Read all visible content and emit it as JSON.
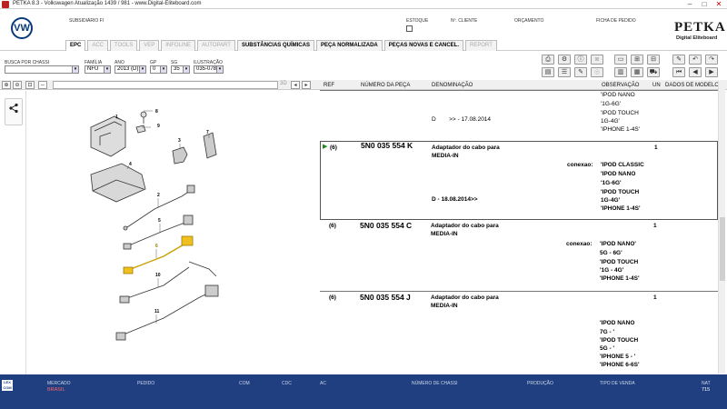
{
  "window": {
    "title": "PETKA 8.3 - Volkswagen Atualização 1439 / 981 - www.Digital-Eliteboard.com"
  },
  "header": {
    "brand_logo": "VW",
    "subsidiary_label": "SUBSIDIÁRIO FI",
    "estoque_label": "ESTOQUE",
    "cliente_label": "Nº. CLIENTE",
    "orcamento_label": "ORÇAMENTO",
    "ficha_label": "FICHA DE PEDIDO",
    "petka_title": "PETKA",
    "petka_sub": "Digital Eliteboard"
  },
  "tabs": [
    {
      "label": "EPC",
      "state": "active"
    },
    {
      "label": "ACC",
      "state": "disabled"
    },
    {
      "label": "TOOLS",
      "state": "disabled"
    },
    {
      "label": "VEP",
      "state": "disabled"
    },
    {
      "label": "INFOLINE",
      "state": "disabled"
    },
    {
      "label": "AUTOPART",
      "state": "disabled"
    },
    {
      "label": "SUBSTÂNCIAS QUÍMICAS",
      "state": "enabled"
    },
    {
      "label": "PEÇA NORMALIZADA",
      "state": "enabled"
    },
    {
      "label": "PEÇAS NOVAS E CANCEL.",
      "state": "enabled"
    },
    {
      "label": "REPORT",
      "state": "disabled"
    }
  ],
  "filters": {
    "chassi_label": "BUSCA POR CHASSI",
    "chassi_value": "",
    "familia_label": "FAMÍLIA",
    "familia_value": "NFU",
    "ano_label": "ANO",
    "ano_value": "2013 (D)",
    "gp_label": "GP",
    "gp_value": "0",
    "sg_label": "SG",
    "sg_value": "35",
    "ilustracao_label": "ILUSTRAÇÃO",
    "ilustracao_value": "035-078"
  },
  "zoom_page": "3D",
  "table": {
    "headers": {
      "ref": "REF",
      "part_number": "NÚMERO DA PEÇA",
      "denominacao": "DENOMINAÇÃO",
      "observacao": "OBSERVAÇÃO",
      "un": "UN",
      "dados": "DADOS DE MODELO"
    },
    "top_partial": {
      "obs": [
        "'IPOD NANO",
        "'1G-6G'",
        "'IPOD TOUCH",
        "1G-4G'",
        "'IPHONE 1-4S'"
      ],
      "validity": "D        >> - 17.08.2014"
    },
    "rows": [
      {
        "ref": "(6)",
        "part_number": "5N0 035 554 K",
        "desc1": "Adaptador do cabo para",
        "desc2": "MEDIA-IN",
        "obs_label": "conexao:",
        "obs": [
          "'IPOD CLASSIC",
          "'IPOD NANO",
          "'1G-6G'",
          "'IPOD TOUCH",
          "1G-4G'",
          "'IPHONE 1-4S'"
        ],
        "validity": "D - 18.08.2014>>",
        "un": "1"
      },
      {
        "ref": "(6)",
        "part_number": "5N0 035 554 C",
        "desc1": "Adaptador do cabo para",
        "desc2": "MEDIA-IN",
        "obs_label": "conexao:",
        "obs": [
          "'IPOD NANO'",
          "5G - 6G'",
          "'IPOD TOUCH",
          "'1G - 4G'",
          "'IPHONE 1-4S'"
        ],
        "un": "1"
      },
      {
        "ref": "(6)",
        "part_number": "5N0 035 554 J",
        "desc1": "Adaptador do cabo para",
        "desc2": "MEDIA-IN",
        "obs": [
          "'IPOD NANO",
          "7G - '",
          "'IPOD TOUCH",
          "5G - '",
          "'IPHONE 5 - '",
          "'IPHONE 6-6S'"
        ],
        "un": "1"
      }
    ]
  },
  "diagram": {
    "callouts": [
      "8",
      "9",
      "7",
      "3",
      "1",
      "4",
      "2",
      "5",
      "6",
      "10",
      "11"
    ]
  },
  "statusbar": {
    "logo": "LEX COM",
    "mercado_label": "MERCADO",
    "mercado_value": "BRASIL",
    "pedido_label": "PEDIDO",
    "com_label": "COM",
    "cdc_label": "CDC",
    "ac_label": "AC",
    "chassi_label": "NÚMERO DE CHASSI",
    "producao_label": "PRODUÇÃO",
    "venda_label": "TIPO DE VENDA",
    "nat_label": "NAT",
    "nat_value": "715"
  },
  "colors": {
    "statusbar_bg": "#1f3f80",
    "brand_blue": "#0a3a75",
    "selected_highlight": "#ffe9a0"
  }
}
